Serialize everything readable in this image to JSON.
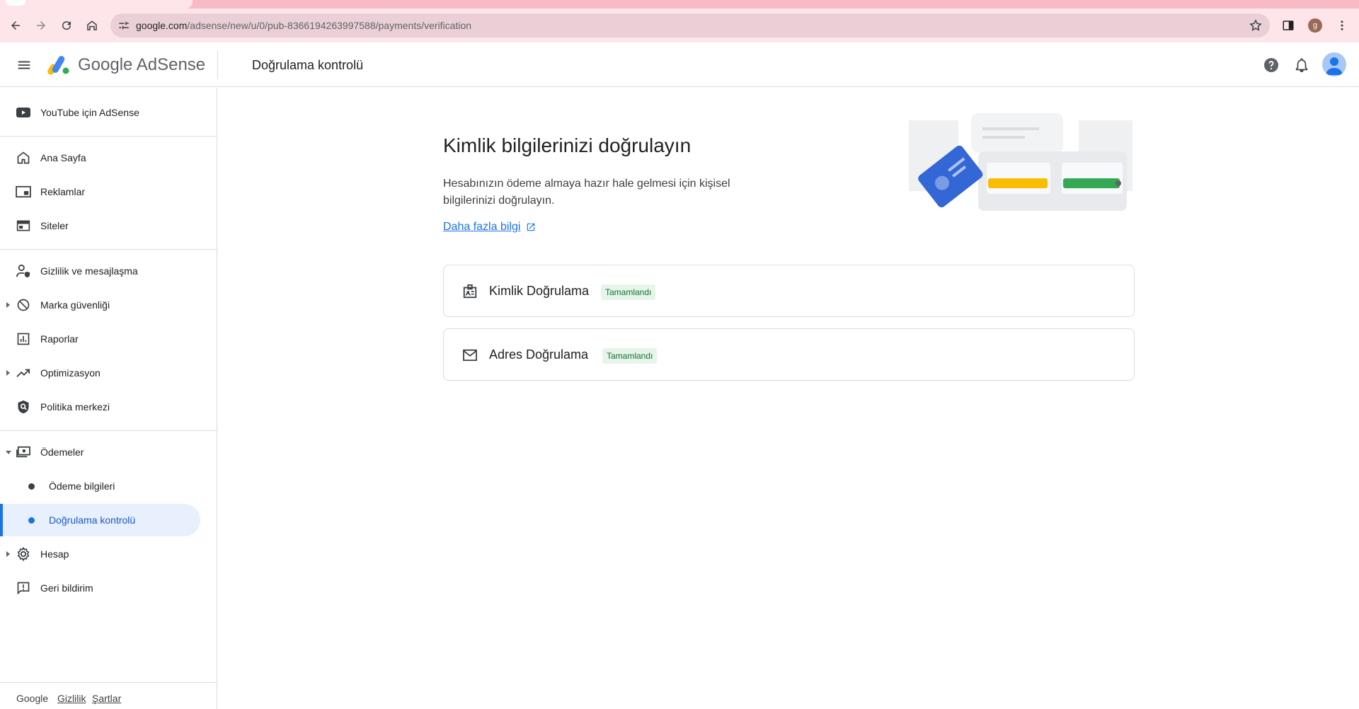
{
  "browser": {
    "url_host": "google.com",
    "url_path": "/adsense/new/u/0/pub-8366194263997588/payments/verification",
    "profile_initial": "g"
  },
  "header": {
    "brand": "Google AdSense",
    "page_title": "Doğrulama kontrolü"
  },
  "sidebar": {
    "items": [
      {
        "label": "YouTube için AdSense"
      },
      {
        "label": "Ana Sayfa"
      },
      {
        "label": "Reklamlar"
      },
      {
        "label": "Siteler"
      },
      {
        "label": "Gizlilik ve mesajlaşma"
      },
      {
        "label": "Marka güvenliği"
      },
      {
        "label": "Raporlar"
      },
      {
        "label": "Optimizasyon"
      },
      {
        "label": "Politika merkezi"
      },
      {
        "label": "Ödemeler"
      },
      {
        "label": "Ödeme bilgileri"
      },
      {
        "label": "Doğrulama kontrolü"
      },
      {
        "label": "Hesap"
      },
      {
        "label": "Geri bildirim"
      }
    ],
    "footer": {
      "google": "Google",
      "privacy": "Gizlilik",
      "terms": "Şartlar"
    }
  },
  "main": {
    "title": "Kimlik bilgilerinizi doğrulayın",
    "description": "Hesabınızın ödeme almaya hazır hale gelmesi için kişisel bilgilerinizi doğrulayın.",
    "learn_more": "Daha fazla bilgi",
    "cards": [
      {
        "title": "Kimlik Doğrulama",
        "status": "Tamamlandı"
      },
      {
        "title": "Adres Doğrulama",
        "status": "Tamamlandı"
      }
    ]
  },
  "colors": {
    "accent": "#1a73e8",
    "active_bg": "#e8f0fe",
    "badge_bg": "#e6f4ea",
    "badge_text": "#137333",
    "browser_frame": "#fde5ea"
  }
}
